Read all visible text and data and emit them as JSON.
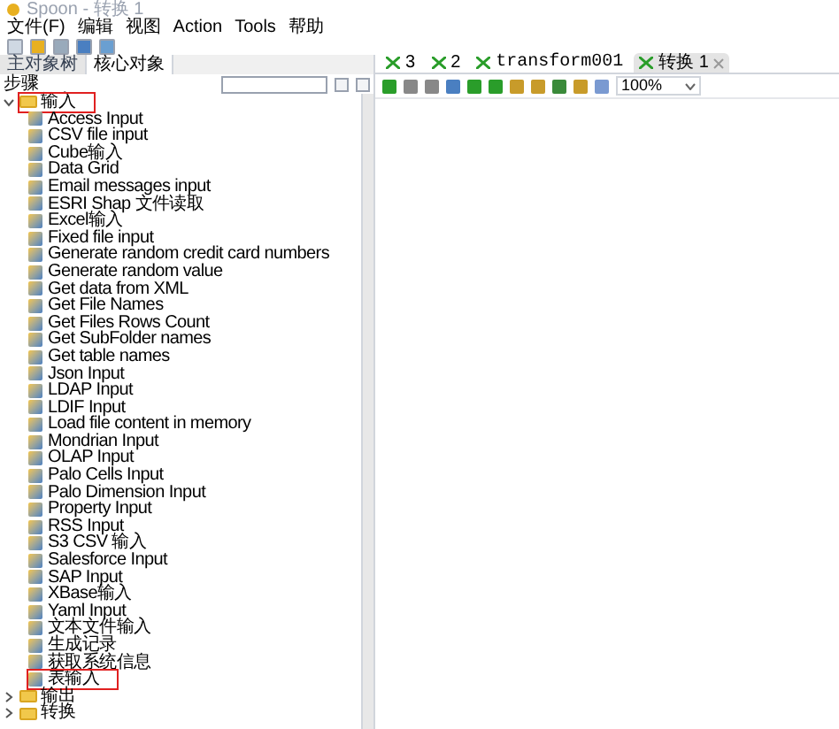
{
  "window": {
    "title": "Spoon - 转换 1"
  },
  "menu": [
    "文件(F)",
    "编辑",
    "视图",
    "Action",
    "Tools",
    "帮助"
  ],
  "left_tabs": [
    {
      "label": "主对象树",
      "selected": false
    },
    {
      "label": "核心对象",
      "selected": true
    }
  ],
  "steps_panel": {
    "title": "步骤"
  },
  "tree": [
    {
      "label": "输入",
      "expanded": true,
      "highlighted": true,
      "children": [
        {
          "label": "Access Input",
          "highlighted": false
        },
        {
          "label": "CSV file input",
          "highlighted": false
        },
        {
          "label": "Cube输入",
          "highlighted": false
        },
        {
          "label": "Data Grid",
          "highlighted": false
        },
        {
          "label": "Email messages input",
          "highlighted": false
        },
        {
          "label": "ESRI Shap 文件读取",
          "highlighted": false
        },
        {
          "label": "Excel输入",
          "highlighted": false
        },
        {
          "label": "Fixed file input",
          "highlighted": false
        },
        {
          "label": "Generate random credit card numbers",
          "highlighted": false
        },
        {
          "label": "Generate random value",
          "highlighted": false
        },
        {
          "label": "Get data from XML",
          "highlighted": false
        },
        {
          "label": "Get File Names",
          "highlighted": false
        },
        {
          "label": "Get Files Rows Count",
          "highlighted": false
        },
        {
          "label": "Get SubFolder names",
          "highlighted": false
        },
        {
          "label": "Get table names",
          "highlighted": false
        },
        {
          "label": "Json Input",
          "highlighted": false
        },
        {
          "label": "LDAP Input",
          "highlighted": false
        },
        {
          "label": "LDIF Input",
          "highlighted": false
        },
        {
          "label": "Load file content in memory",
          "highlighted": false
        },
        {
          "label": "Mondrian Input",
          "highlighted": false
        },
        {
          "label": "OLAP Input",
          "highlighted": false
        },
        {
          "label": "Palo Cells Input",
          "highlighted": false
        },
        {
          "label": "Palo Dimension Input",
          "highlighted": false
        },
        {
          "label": "Property Input",
          "highlighted": false
        },
        {
          "label": "RSS Input",
          "highlighted": false
        },
        {
          "label": "S3 CSV 输入",
          "highlighted": false
        },
        {
          "label": "Salesforce Input",
          "highlighted": false
        },
        {
          "label": "SAP Input",
          "highlighted": false
        },
        {
          "label": "XBase输入",
          "highlighted": false
        },
        {
          "label": "Yaml Input",
          "highlighted": false
        },
        {
          "label": "文本文件输入",
          "highlighted": false
        },
        {
          "label": "生成记录",
          "highlighted": false
        },
        {
          "label": "获取系统信息",
          "highlighted": false
        },
        {
          "label": "表输入",
          "highlighted": true
        }
      ]
    },
    {
      "label": "输出",
      "expanded": false,
      "highlighted": false
    },
    {
      "label": "转换",
      "expanded": false,
      "highlighted": false
    }
  ],
  "editor_tabs": [
    {
      "label": "3",
      "selected": false,
      "closable": false
    },
    {
      "label": "2",
      "selected": false,
      "closable": false
    },
    {
      "label": "transform001",
      "selected": false,
      "closable": false
    },
    {
      "label": "转换 1",
      "selected": true,
      "closable": true
    }
  ],
  "zoom": {
    "value": "100%"
  }
}
